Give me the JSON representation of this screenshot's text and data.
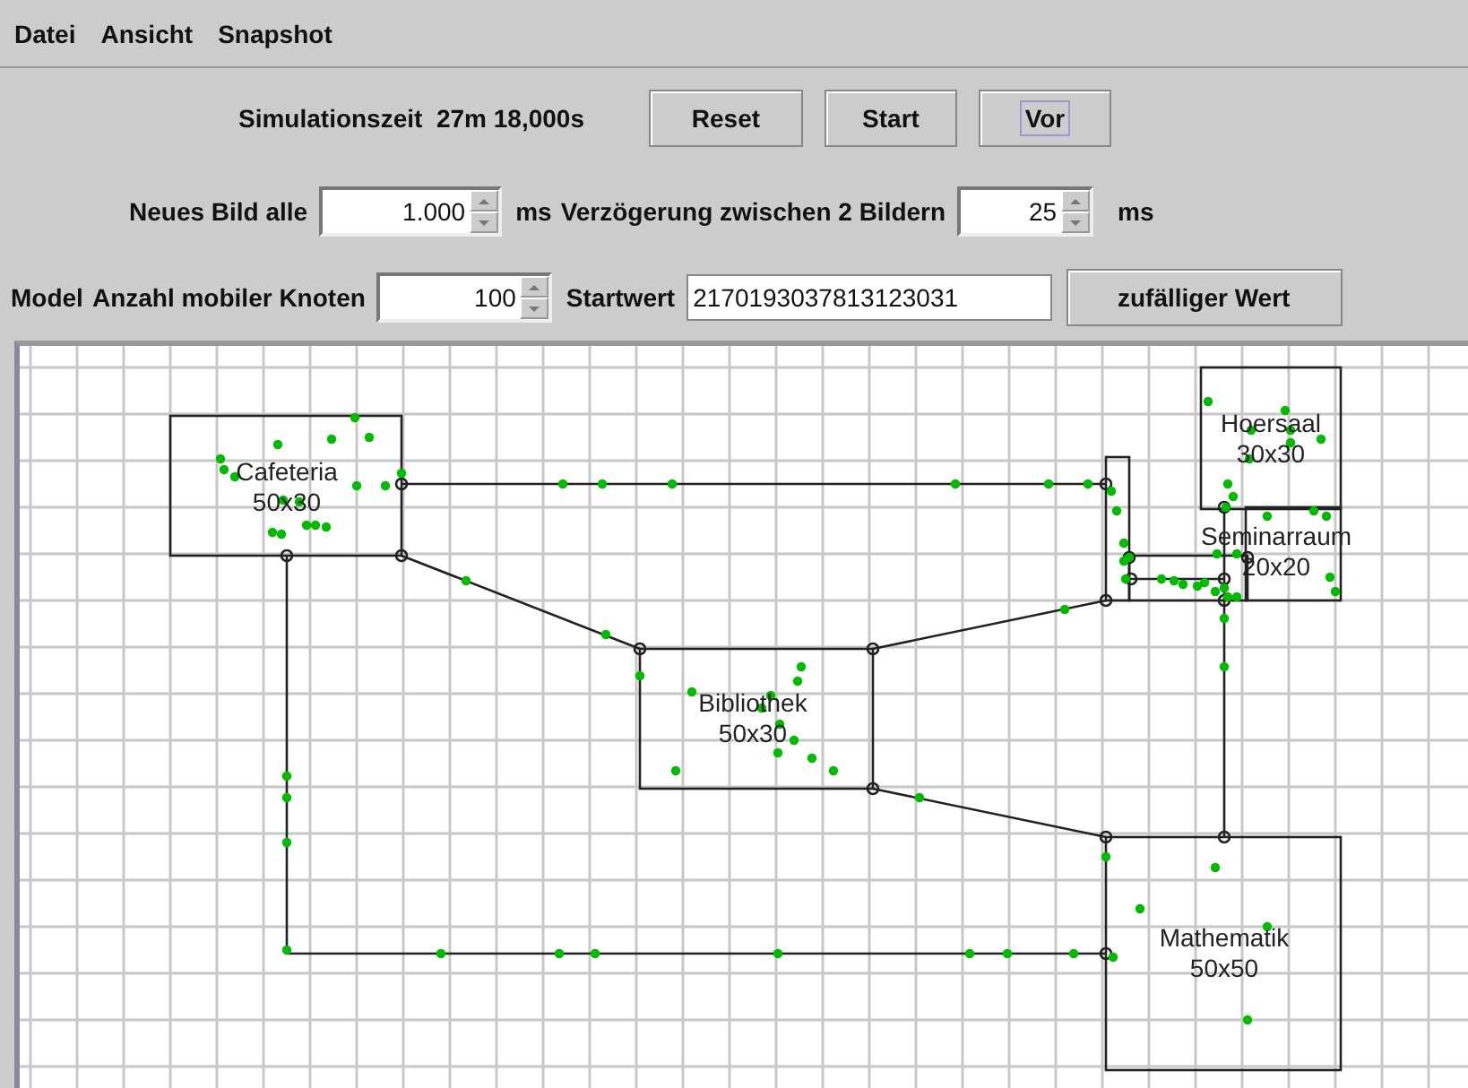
{
  "menu": [
    {
      "label": "Datei"
    },
    {
      "label": "Ansicht"
    },
    {
      "label": "Snapshot"
    }
  ],
  "simulation_time": "Simulationszeit  27m 18,000s",
  "controls": [
    {
      "label": "Reset",
      "focused": false
    },
    {
      "label": "Start",
      "focused": false
    },
    {
      "label": "Vor",
      "focused": true
    }
  ],
  "frame_interval": {
    "label": "Neues Bild alle",
    "value": "1.000",
    "unit": "ms"
  },
  "delay": {
    "label": "Verzögerung zwischen 2 Bildern",
    "value": "25",
    "unit": "ms"
  },
  "model": {
    "label": "Model",
    "nodes_label": "Anzahl mobiler Knoten",
    "nodes_value": "100",
    "seed_label": "Startwert",
    "seed_value": "2170193037813123031",
    "random_button": "zufälliger Wert"
  },
  "rooms": [
    {
      "name": "Cafeteria",
      "size": "50x30"
    },
    {
      "name": "Hoersaal",
      "size": "30x30"
    },
    {
      "name": "Seminarraum",
      "size": "20x20"
    },
    {
      "name": "Bibliothek",
      "size": "50x30"
    },
    {
      "name": "Mathematik",
      "size": "50x50"
    }
  ]
}
